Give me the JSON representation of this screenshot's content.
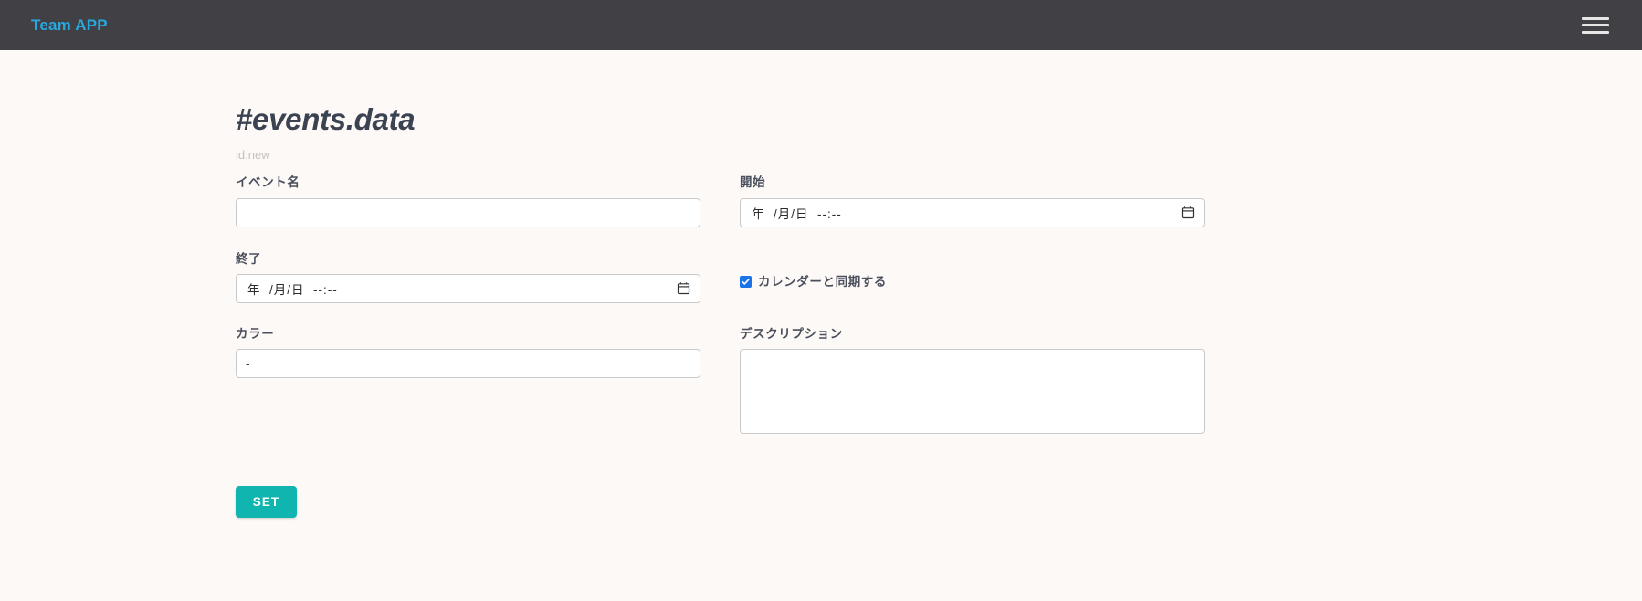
{
  "header": {
    "brand": "Team APP",
    "menu_icon": "hamburger-icon"
  },
  "page": {
    "title": "#events.data",
    "subtitle": "id:new"
  },
  "form": {
    "event_name": {
      "label": "イベント名",
      "value": "",
      "placeholder": ""
    },
    "start": {
      "label": "開始",
      "value": "",
      "placeholder": "年  /月/日  --:--"
    },
    "end": {
      "label": "終了",
      "value": "",
      "placeholder": "年  /月/日  --:--"
    },
    "sync_calendar": {
      "label": "カレンダーと同期する",
      "checked": true
    },
    "color": {
      "label": "カラー",
      "value": "-",
      "options": [
        "-"
      ]
    },
    "description": {
      "label": "デスクリプション",
      "value": "",
      "placeholder": ""
    },
    "submit": {
      "label": "SET"
    }
  },
  "colors": {
    "appbar_bg": "#414145",
    "brand": "#29a8e0",
    "page_bg": "#fdf9f7",
    "accent": "#0fb5ae",
    "checkbox": "#1a73e8",
    "title": "#3b4252",
    "subtitle": "#c6c1be"
  }
}
